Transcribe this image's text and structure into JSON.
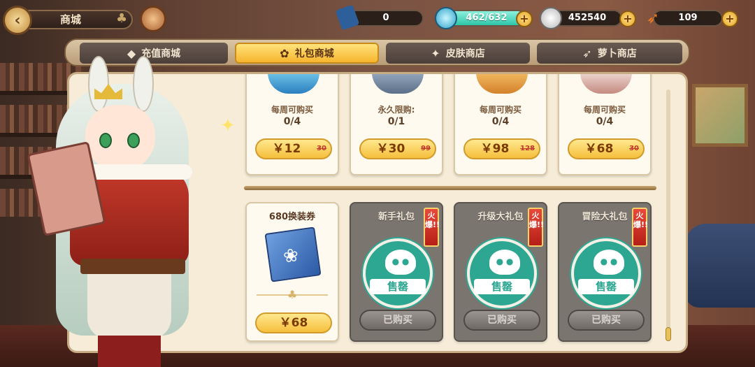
{
  "header": {
    "title": "商城",
    "back_icon": "chevron-left-icon"
  },
  "resources": {
    "tickets": "0",
    "stamina": "462/632",
    "coins": "452540",
    "carrots": "109"
  },
  "tabs": [
    {
      "label": "充值商城",
      "icon": "crystal-icon"
    },
    {
      "label": "礼包商城",
      "icon": "gift-bag-icon"
    },
    {
      "label": "皮肤商店",
      "icon": "skin-icon"
    },
    {
      "label": "萝卜商店",
      "icon": "carrot-icon"
    }
  ],
  "top_cards": [
    {
      "limit_type": "每周可购买",
      "count": "0/4",
      "price": "￥12",
      "old_price": "30"
    },
    {
      "limit_type": "永久限购:",
      "count": "0/1",
      "price": "￥30",
      "old_price": "99"
    },
    {
      "limit_type": "每周可购买",
      "count": "0/4",
      "price": "￥98",
      "old_price": "128"
    },
    {
      "limit_type": "每周可购买",
      "count": "0/4",
      "price": "￥68",
      "old_price": "30"
    }
  ],
  "bottom_cards": [
    {
      "title": "680换装券",
      "price": "￥68"
    },
    {
      "title": "新手礼包",
      "hot": "火爆!!",
      "stamp": "售罄",
      "button": "已购买"
    },
    {
      "title": "升级大礼包",
      "hot": "火爆!!",
      "stamp": "售罄",
      "button": "已购买"
    },
    {
      "title": "冒险大礼包",
      "hot": "火爆!!",
      "stamp": "售罄",
      "button": "已购买"
    }
  ],
  "colors": {
    "active_tab": "#f6b52d",
    "price_button": "#f5bf3c",
    "sold_stamp": "#2ea792",
    "hot_tag": "#d2342a"
  }
}
